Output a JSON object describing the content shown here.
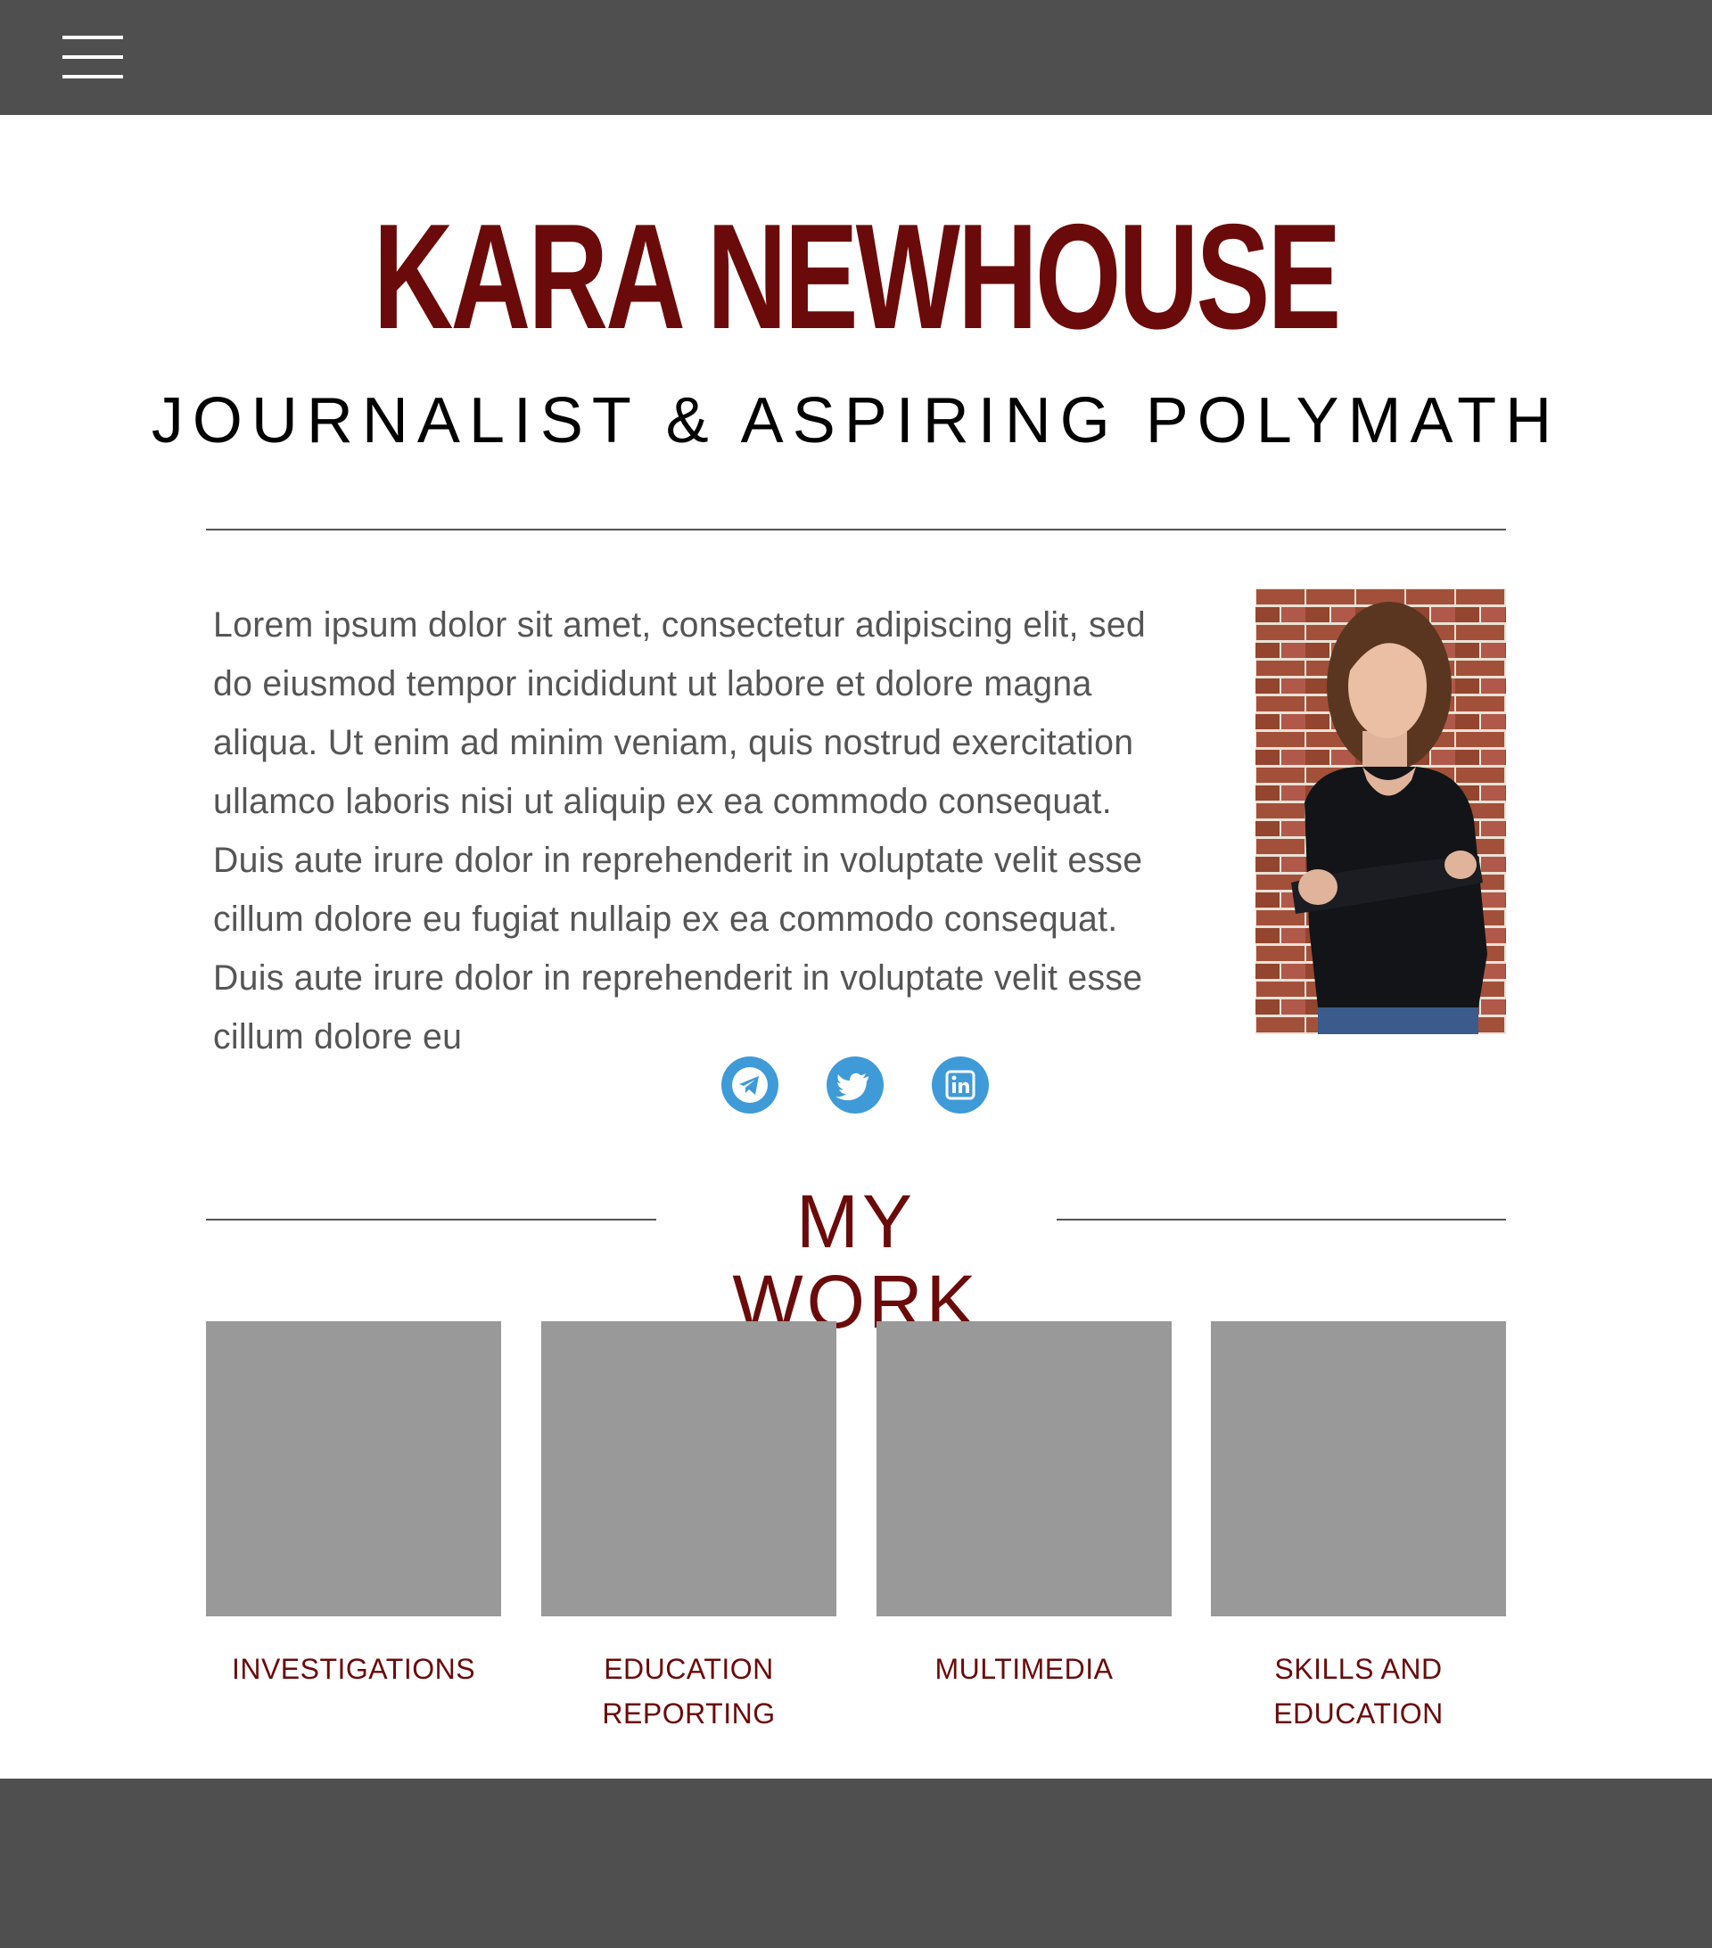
{
  "header": {
    "menu_icon": "hamburger-menu-icon"
  },
  "hero": {
    "name": "KARA NEWHOUSE",
    "tagline": "JOURNALIST & ASPIRING POLYMATH"
  },
  "bio": {
    "text": "Lorem ipsum dolor sit amet, consectetur adipiscing elit, sed do eiusmod tempor incididunt ut labore et dolore magna aliqua. Ut enim ad minim veniam, quis nostrud exercitation ullamco laboris nisi ut aliquip ex ea commodo consequat. Duis aute irure dolor in reprehenderit in voluptate velit esse cillum dolore eu fugiat nullaip ex ea commodo consequat. Duis aute irure dolor in reprehenderit in voluptate velit esse cillum dolore eu"
  },
  "social": {
    "items": [
      {
        "icon": "telegram-icon"
      },
      {
        "icon": "twitter-icon"
      },
      {
        "icon": "linkedin-icon"
      }
    ],
    "color": "#3f9ad8"
  },
  "work": {
    "title": "MY WORK",
    "items": [
      {
        "line1": "INVESTIGATIONS",
        "line2": ""
      },
      {
        "line1": "EDUCATION",
        "line2": "REPORTING"
      },
      {
        "line1": "MULTIMEDIA",
        "line2": ""
      },
      {
        "line1": "SKILLS AND",
        "line2": "EDUCATION"
      }
    ]
  },
  "colors": {
    "bar": "#4f4f4f",
    "accent": "#6b0a0a",
    "tile": "#999999",
    "body_text": "#555555"
  }
}
